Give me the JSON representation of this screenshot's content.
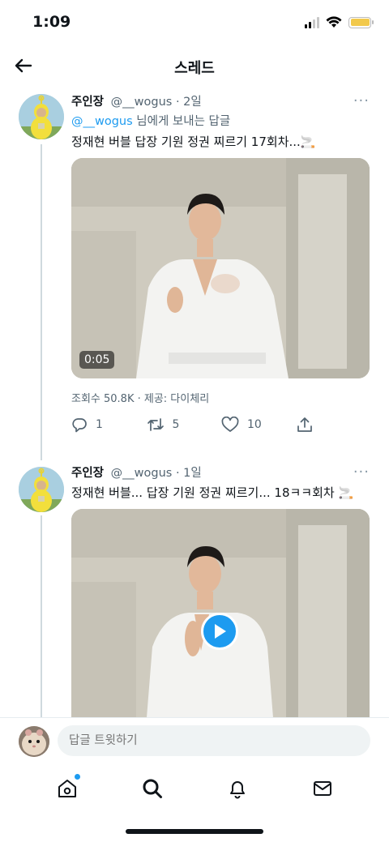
{
  "status_bar": {
    "time": "1:09"
  },
  "header": {
    "title": "스레드"
  },
  "tweets": [
    {
      "name": "주인장",
      "handle": "@__wogus",
      "time": "· 2일",
      "reply_to_handle": "@__wogus",
      "reply_to_suffix": " 님에게 보내는 답글",
      "text": "정재현 버블 답장 기원 정권 찌르기 17회차...🚬",
      "video_duration": "0:05",
      "views": "조회수 50.8K · 제공: 다이체리",
      "replies": "1",
      "retweets": "5",
      "likes": "10"
    },
    {
      "name": "주인장",
      "handle": "@__wogus",
      "time": "· 1일",
      "text": "정재현 버블... 답장 기원 정권 찌르기... 18ㅋㅋ회차 🚬"
    }
  ],
  "reply_bar": {
    "placeholder": "답글 트윗하기"
  },
  "tabbar": {
    "items": [
      "home-icon",
      "search-icon",
      "bell-icon",
      "mail-icon"
    ]
  }
}
